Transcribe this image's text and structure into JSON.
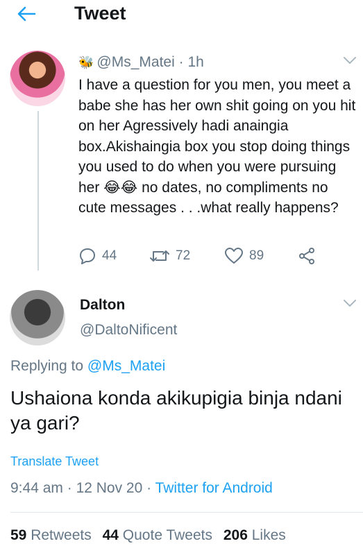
{
  "header": {
    "title": "Tweet",
    "back_icon": "arrow-left-icon",
    "accent": "#1da1f2"
  },
  "original_tweet": {
    "handle": "@Ms_Matei",
    "time": "1h",
    "badge_emoji": "🐝",
    "text": "I have a question for you men, you meet a babe she has her own shit going on you hit on her Agressively hadi anaingia box.Akishaingia box you stop doing things you used to do when you were pursuing her 😂😂 no dates, no compliments no cute messages . . .what really happens?",
    "replies": "44",
    "retweets": "72",
    "likes": "89"
  },
  "reply": {
    "name": "Dalton",
    "handle": "@DaltoNificent",
    "replying_prefix": "Replying to ",
    "replying_to": "@Ms_Matei",
    "text": "Ushaiona konda akikupigia binja ndani ya gari?",
    "translate": "Translate Tweet",
    "time": "9:44 am",
    "date": "12 Nov 20",
    "client": "Twitter for Android",
    "sep": " · "
  },
  "stats": {
    "retweets_count": "59",
    "retweets_label": "Retweets",
    "quotes_count": "44",
    "quotes_label": "Quote Tweets",
    "likes_count": "206",
    "likes_label": "Likes"
  }
}
